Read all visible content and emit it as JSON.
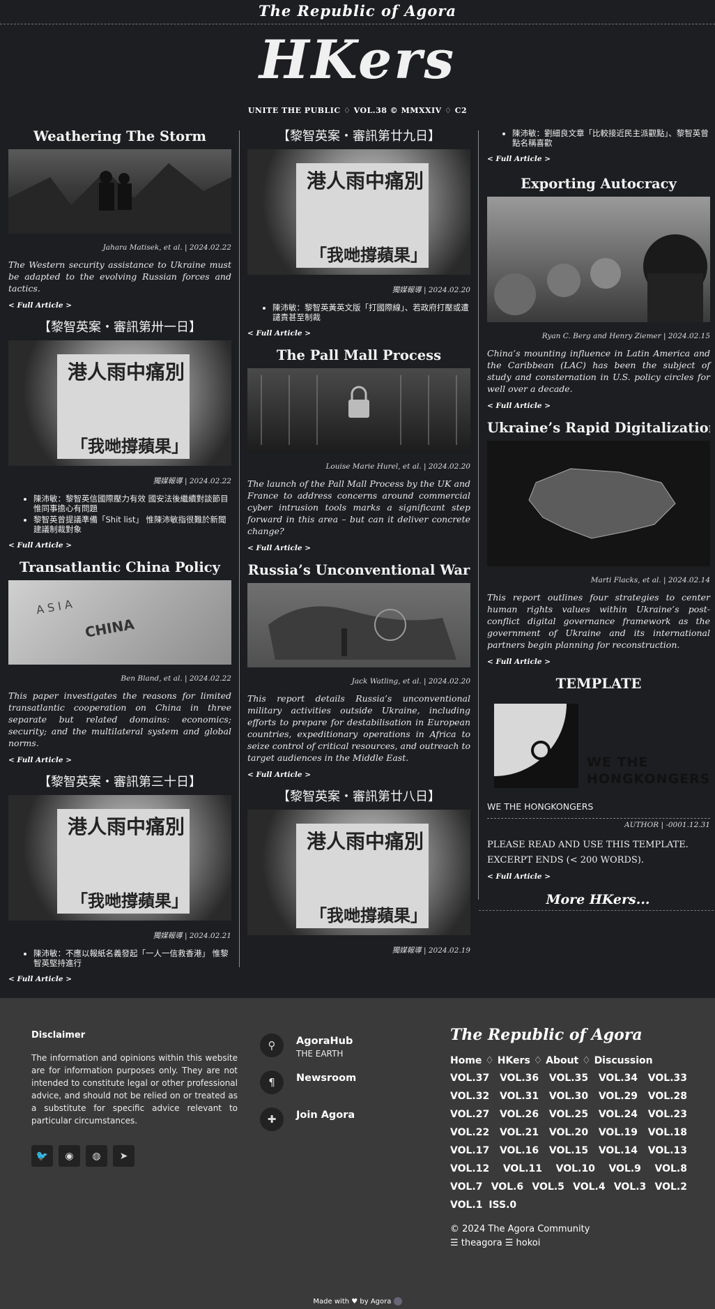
{
  "site_title": "The Republic of Agora",
  "masthead": "HKers",
  "subtitle": "UNITE THE PUBLIC ♢ VOL.38 © MMXXIV ♢ C2",
  "more_label": "< Full Article >",
  "col1": [
    {
      "title": "Weathering The Storm",
      "meta": "Jahara Matisek, et al. | 2024.02.22",
      "desc": "The Western security assistance to Ukraine must be adapted to the evolving Russian forces and tactics."
    },
    {
      "title": "【黎智英案・審訊第卅一日】",
      "meta": "獨媒報導 | 2024.02.22",
      "notes": [
        "陳沛敏：黎智英信國際壓力有效 國安法後繼續對談節目 惟同事擔心有問題",
        "黎智英曾提議準備「Shit list」 惟陳沛敏指很難於新聞建議制裁對象"
      ]
    },
    {
      "title": "Transatlantic China Policy",
      "meta": "Ben Bland, et al. | 2024.02.22",
      "desc": "This paper investigates the reasons for limited transatlantic cooperation on China in three separate but related domains: economics; security; and the multilateral system and global norms."
    },
    {
      "title": "【黎智英案・審訊第三十日】",
      "meta": "獨媒報導 | 2024.02.21",
      "notes": [
        "陳沛敏：不應以報紙名義發起「一人一信救香港」 惟黎智英堅持進行"
      ]
    }
  ],
  "col2": [
    {
      "title": "【黎智英案・審訊第廿九日】",
      "meta": "獨媒報導 | 2024.02.20",
      "notes": [
        "陳沛敏：黎智英黃英文版「打國際線」、若政府打壓或遭譴責甚至制裁"
      ]
    },
    {
      "title": "The Pall Mall Process",
      "meta": "Louise Marie Hurel, et al. | 2024.02.20",
      "desc": "The launch of the Pall Mall Process by the UK and France to address concerns around commercial cyber intrusion tools marks a significant step forward in this area – but can it deliver concrete change?"
    },
    {
      "title": "Russia’s Unconventional War",
      "meta": "Jack Watling, et al. | 2024.02.20",
      "desc": "This report details Russia’s unconventional military activities outside Ukraine, including efforts to prepare for destabilisation in European countries, expeditionary operations in Africa to seize control of critical resources, and outreach to target audiences in the Middle East."
    },
    {
      "title": "【黎智英案・審訊第廿八日】",
      "meta": "獨媒報導 | 2024.02.19"
    }
  ],
  "col3_top_note": "陳沛敏：劉細良文章「比較接近民主派觀點」、黎智英曾點名稱喜歡",
  "col3": [
    {
      "title": "Exporting Autocracy",
      "meta": "Ryan C. Berg and Henry Ziemer | 2024.02.15",
      "desc": "China’s mounting influence in Latin America and the Caribbean (LAC) has been the subject of study and consternation in U.S. policy circles for well over a decade."
    },
    {
      "title": "Ukraine’s Rapid Digitalization",
      "meta": "Marti Flacks, et al. | 2024.02.14",
      "desc": "This report outlines four strategies to center human rights values within Ukraine’s post-conflict digital governance framework as the government of Ukraine and its international partners begin planning for reconstruction."
    }
  ],
  "template": {
    "title": "TEMPLATE",
    "logo_text_1": "WE THE",
    "logo_text_2": "HONGKONGERS",
    "name": "WE THE HONGKONGERS",
    "meta": "AUTHOR | -0001.12.31",
    "body": "PLEASE READ AND USE THIS TEMPLATE. EXCERPT ENDS (< 200 WORDS)."
  },
  "more_hkers": "More HKers...",
  "footer": {
    "disclaimer_title": "Disclaimer",
    "disclaimer_text": "The information and opinions within this website are for information purposes only. They are not intended to constitute legal or other professional advice, and should not be relied on or treated as a substitute for specific advice relevant to particular circumstances.",
    "links": [
      {
        "label": "AgoraHub",
        "sub": "THE EARTH",
        "icon": "map-pin-icon"
      },
      {
        "label": "Newsroom",
        "sub": "",
        "icon": "pilcrow-icon"
      },
      {
        "label": "Join Agora",
        "sub": "",
        "icon": "puzzle-icon"
      }
    ],
    "agora_title": "The Republic of Agora",
    "nav": [
      "Home",
      "HKers",
      "About",
      "Discussion"
    ],
    "vols": "VOL.37 VOL.36 VOL.35 VOL.34 VOL.33 VOL.32 VOL.31 VOL.30 VOL.29 VOL.28 VOL.27 VOL.26 VOL.25 VOL.24 VOL.23 VOL.22 VOL.21 VOL.20 VOL.19 VOL.18 VOL.17 VOL.16 VOL.15 VOL.14 VOL.13 VOL.12 VOL.11 VOL.10 VOL.9 VOL.8 VOL.7 VOL.6 VOL.5 VOL.4 VOL.3 VOL.2 VOL.1 ISS.0",
    "copyright": "© 2024 The Agora Community",
    "credits": "☰ theagora ☰ hokoi",
    "made_with": "Made with ♥ by Agora"
  }
}
